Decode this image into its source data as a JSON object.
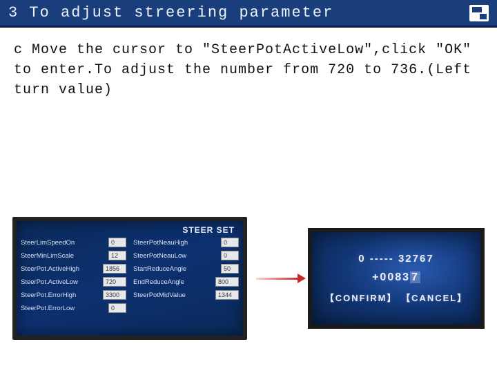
{
  "header": {
    "title": "3 To adjust streering parameter"
  },
  "instruction": "c Move the cursor to  \"SteerPotActiveLow\",click \"OK\" to enter.To adjust the number from 720 to 736.(Left turn value)",
  "steer_set": {
    "title": "STEER SET",
    "left": [
      {
        "label": "SteerLimSpeedOn",
        "value": "0"
      },
      {
        "label": "SteerMinLimScale",
        "value": "12"
      },
      {
        "label": "SteerPot.ActiveHigh",
        "value": "1856"
      },
      {
        "label": "SteerPot.ActiveLow",
        "value": "720"
      },
      {
        "label": "SteerPot.ErrorHigh",
        "value": "3300"
      },
      {
        "label": "SteerPot.ErrorLow",
        "value": "0"
      }
    ],
    "right": [
      {
        "label": "SteerPotNeauHigh",
        "value": "0"
      },
      {
        "label": "SteerPotNeauLow",
        "value": "0"
      },
      {
        "label": "StartReduceAngle",
        "value": "50"
      },
      {
        "label": "EndReduceAngle",
        "value": "800"
      },
      {
        "label": "SteerPotMidValue",
        "value": "1344"
      }
    ]
  },
  "edit_panel": {
    "range_min": "0",
    "range_sep": "-----",
    "range_max": "32767",
    "value_prefix": "+0083",
    "value_selected": "7",
    "confirm": "【CONFIRM】",
    "cancel": "【CANCEL】"
  }
}
